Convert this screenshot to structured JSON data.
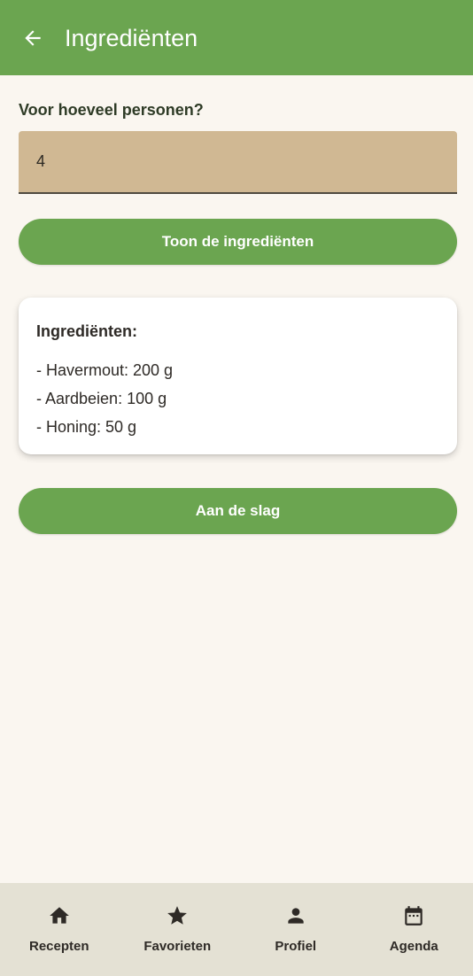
{
  "appbar": {
    "title": "Ingrediënten",
    "back_icon": "arrow-left-icon"
  },
  "form": {
    "question": "Voor hoeveel personen?",
    "persons_value": "4"
  },
  "buttons": {
    "show_label": "Toon de ingrediënten",
    "start_label": "Aan de slag"
  },
  "card": {
    "title": "Ingrediënten:",
    "items": [
      "- Havermout: 200 g",
      "- Aardbeien: 100 g",
      "- Honing: 50 g"
    ]
  },
  "nav": {
    "items": [
      {
        "label": "Recepten",
        "icon": "home-icon"
      },
      {
        "label": "Favorieten",
        "icon": "star-icon"
      },
      {
        "label": "Profiel",
        "icon": "person-icon"
      },
      {
        "label": "Agenda",
        "icon": "calendar-icon"
      }
    ]
  },
  "colors": {
    "primary_green": "#6ba550",
    "field_tan": "#d0b893",
    "background": "#faf6f0",
    "nav_background": "#e4e1d4"
  }
}
